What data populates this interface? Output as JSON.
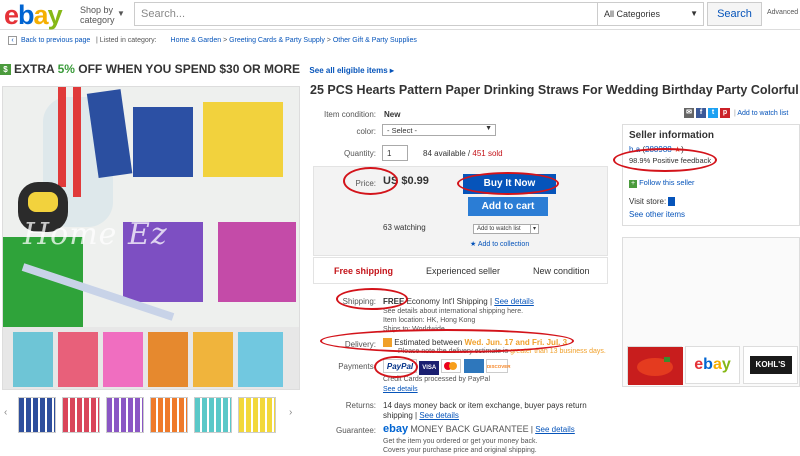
{
  "header": {
    "logo_letters": [
      {
        "ch": "e",
        "color": "#e53238"
      },
      {
        "ch": "b",
        "color": "#0064d2"
      },
      {
        "ch": "a",
        "color": "#f5af02"
      },
      {
        "ch": "y",
        "color": "#86b817"
      }
    ],
    "shop_by_category": "Shop by category",
    "search_placeholder": "Search...",
    "category_select": "All Categories",
    "search_button": "Search",
    "advanced": "Advanced"
  },
  "breadcrumb": {
    "back": "Back to previous page",
    "listed_in": "| Listed in category:",
    "items": [
      "Home & Garden",
      "Greeting Cards & Party Supply",
      "Other Gift & Party Supplies"
    ]
  },
  "promo": {
    "prefix": "EXTRA ",
    "pct": "5%",
    "suffix": " OFF WHEN YOU SPEND $30 OR MORE",
    "eligible": "See all eligible items"
  },
  "image": {
    "watermark": "Home Ez"
  },
  "item": {
    "title": "25 PCS Hearts Pattern Paper Drinking Straws For Wedding Birthday Party Colorful",
    "add_to_watch": "Add to watch list",
    "condition_label": "Item condition:",
    "condition_value": "New",
    "color_label": "color:",
    "color_value": "- Select -",
    "quantity_label": "Quantity:",
    "quantity_value": "1",
    "available": "84 available",
    "sold": "451 sold",
    "price_label": "Price:",
    "price": "US $0.99",
    "buy_now": "Buy It Now",
    "add_to_cart": "Add to cart",
    "watching": "63 watching",
    "add_watch_small": "Add to watch list",
    "add_collection": "Add to collection",
    "features": [
      "Free shipping",
      "Experienced seller",
      "New condition"
    ],
    "shipping_label": "Shipping:",
    "shipping_free": "FREE",
    "shipping_text": "Economy Int'l Shipping",
    "see_details": "See details",
    "shipping_note": "See details about international shipping here.",
    "item_location": "Item location:  HK, Hong Kong",
    "ships_to": "Ships to: Worldwide",
    "delivery_label": "Delivery:",
    "delivery_prefix": "Estimated between",
    "delivery_dates": "Wed. Jun. 17 and Fri. Jul. 3",
    "delivery_note": "Please note the delivery estimate is",
    "delivery_note_orange": "greater than 13 business days.",
    "payments_label": "Payments:",
    "paypal": "PayPal",
    "visa": "VISA",
    "discover": "DISCOVER",
    "credit_cards": "Credit Cards processed by PayPal",
    "payment_details": "See details",
    "returns_label": "Returns:",
    "returns_text": "14 days money back or item exchange, buyer pays return shipping |",
    "guarantee_label": "Guarantee:",
    "guarantee_text": "MONEY BACK GUARANTEE",
    "guarantee_ebay": "ebay",
    "guarantee_line1": "Get the item you ordered or get your money back.",
    "guarantee_line2": "Covers your purchase price and original shipping."
  },
  "seller": {
    "header": "Seller information",
    "name": "h                    a",
    "score": "288988",
    "feedback": "98.9% Positive feedback",
    "follow": "Follow this seller",
    "visit_store": "Visit store:",
    "other_items": "See other items"
  },
  "ads": {
    "kohls": "KOHL'S",
    "ebay": "ebay"
  },
  "thumbs": [
    "#2e4e9c",
    "#d9455a",
    "#8a56c4",
    "#ef7a2a",
    "#5ac8c8",
    "#f2d83a"
  ]
}
